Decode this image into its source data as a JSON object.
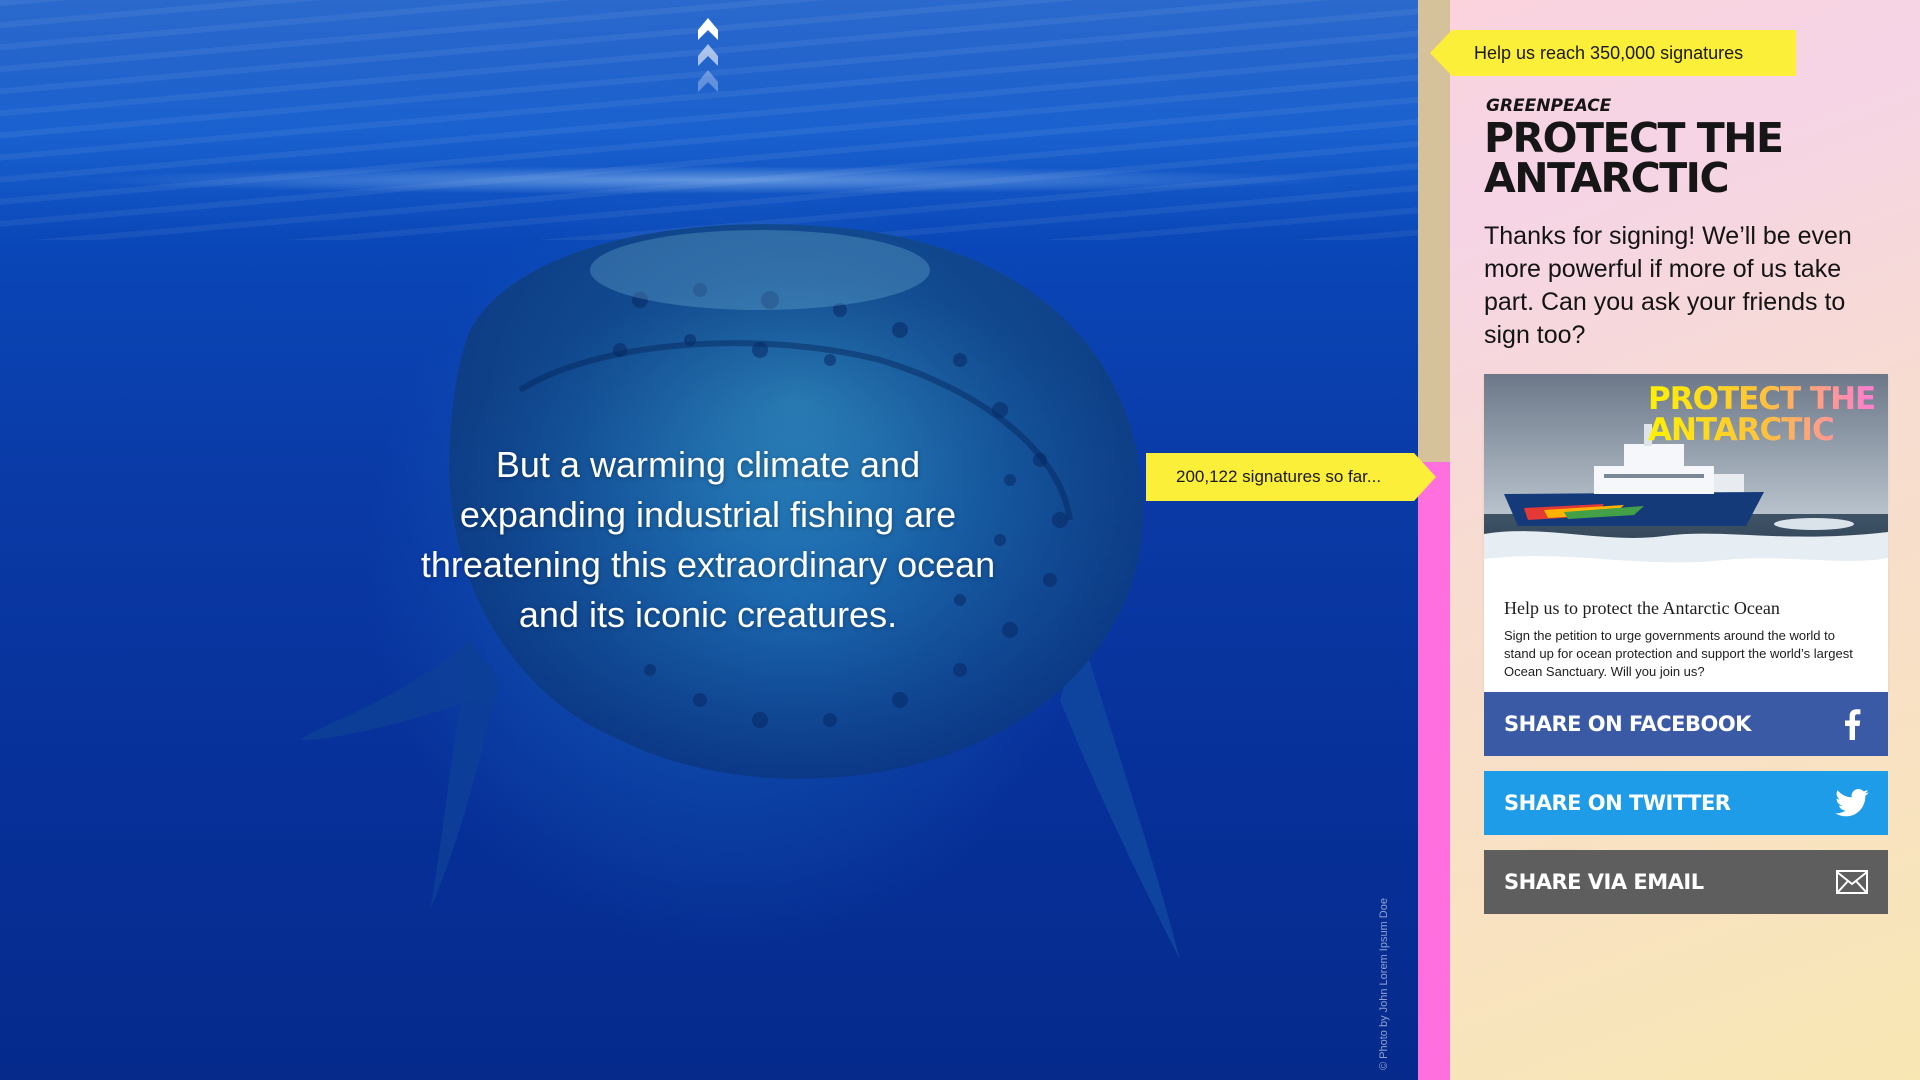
{
  "hero": {
    "scroll_up_label": "Scroll up",
    "message": "But a warming climate and expanding industrial fishing are threatening this extraordinary ocean and its iconic creatures.",
    "photo_credit": "© Photo by John Lorem Ipsum Doe"
  },
  "progress": {
    "current_label": "200,122 signatures so far...",
    "goal_label": "Help us reach 350,000 signatures",
    "current": 200122,
    "goal": 350000,
    "fill_color": "#ff6fdd",
    "track_color": "#d6c29a"
  },
  "panel": {
    "brand": "GREENPEACE",
    "headline": "PROTECT THE ANTARCTIC",
    "thanks_text": "Thanks for signing! We’ll be even more powerful if more of us take part. Can you ask your friends to sign too?"
  },
  "share_card": {
    "image_title": "PROTECT THE ANTARCTIC",
    "title": "Help us to protect the Antarctic Ocean",
    "description": "Sign the petition to urge governments around the world to stand up for ocean protection and support the world’s largest Ocean Sanctuary. Will you join us?"
  },
  "share_buttons": {
    "facebook": {
      "label": "SHARE ON FACEBOOK",
      "icon": "facebook-icon",
      "color": "#3b5aa6"
    },
    "twitter": {
      "label": "SHARE ON TWITTER",
      "icon": "twitter-icon",
      "color": "#1f9ce8"
    },
    "email": {
      "label": "SHARE VIA EMAIL",
      "icon": "envelope-icon",
      "color": "#5e5e5e"
    }
  },
  "colors": {
    "accent_yellow": "#fbef3a",
    "ocean_blue": "#0a3fae"
  }
}
